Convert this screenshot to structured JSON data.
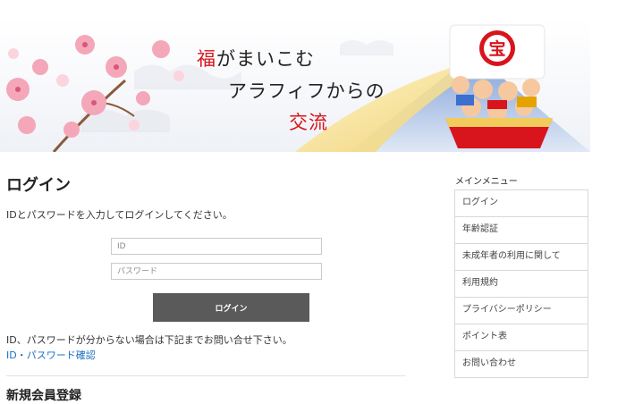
{
  "banner": {
    "line1_red": "福",
    "line1_rest": "がまいこむ",
    "line2": "アラフィフからの",
    "line3": "交流",
    "treasure_char": "宝",
    "colors": {
      "accent_red": "#d8141c",
      "blossom_pink": "#f4a7b9",
      "mountain_blue": "#bcd0ea"
    }
  },
  "login": {
    "heading": "ログイン",
    "description": "IDとパスワードを入力してログインしてください。",
    "id_placeholder": "ID",
    "password_placeholder": "パスワード",
    "button_label": "ログイン",
    "help_text": "ID、パスワードが分からない場合は下記までお問い合せ下さい。",
    "help_link": "ID・パスワード確認"
  },
  "signup": {
    "heading": "新規会員登録"
  },
  "sidebar": {
    "heading": "メインメニュー",
    "items": [
      {
        "label": "ログイン"
      },
      {
        "label": "年齢認証"
      },
      {
        "label": "未成年者の利用に関して"
      },
      {
        "label": "利用規約"
      },
      {
        "label": "プライバシーポリシー"
      },
      {
        "label": "ポイント表"
      },
      {
        "label": "お問い合わせ"
      }
    ]
  }
}
